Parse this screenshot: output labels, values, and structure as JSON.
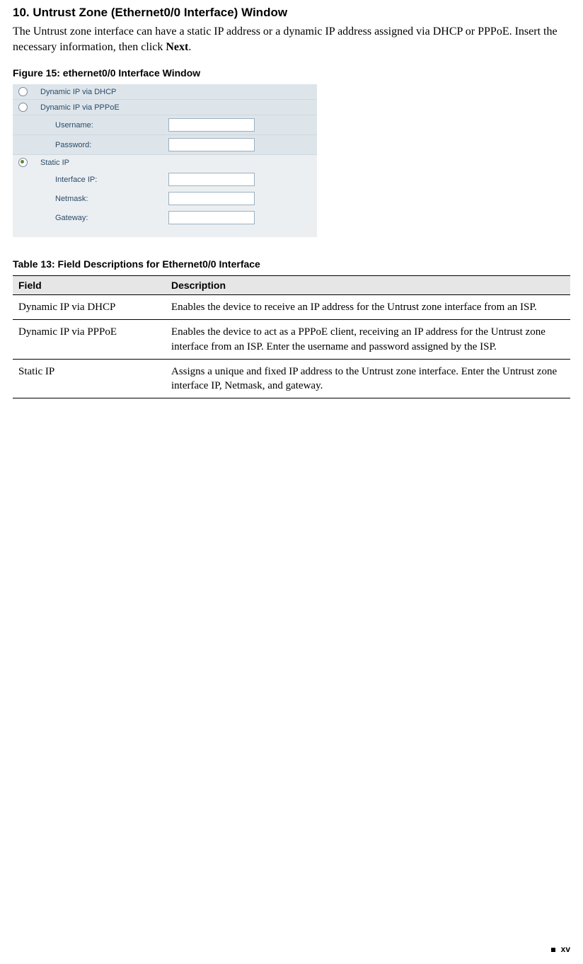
{
  "heading": "10. Untrust Zone (Ethernet0/0 Interface) Window",
  "intro_pre": "The Untrust zone interface can have a static IP address or a dynamic IP address assigned via DHCP or PPPoE. Insert the necessary information, then click ",
  "intro_bold": "Next",
  "intro_post": ".",
  "figure_caption": "Figure 15:  ethernet0/0 Interface Window",
  "panel": {
    "opt_dhcp": "Dynamic IP via DHCP",
    "opt_pppoe": "Dynamic IP via PPPoE",
    "username_label": "Username:",
    "password_label": "Password:",
    "opt_static": "Static IP",
    "interface_ip_label": "Interface IP:",
    "netmask_label": "Netmask:",
    "gateway_label": "Gateway:"
  },
  "table_caption": "Table 13:  Field Descriptions for Ethernet0/0 Interface",
  "table": {
    "header_field": "Field",
    "header_desc": "Description",
    "rows": [
      {
        "field": "Dynamic IP via DHCP",
        "desc": "Enables the device to receive an IP address for the Untrust zone interface from an ISP."
      },
      {
        "field": "Dynamic IP via PPPoE",
        "desc": "Enables the device to act as a PPPoE client, receiving an IP address for the Untrust zone interface from an ISP. Enter the username and password assigned by the ISP."
      },
      {
        "field": "Static IP",
        "desc": "Assigns a unique and fixed IP address to the Untrust zone interface. Enter the Untrust zone interface IP, Netmask, and gateway."
      }
    ]
  },
  "page_number": "xv"
}
